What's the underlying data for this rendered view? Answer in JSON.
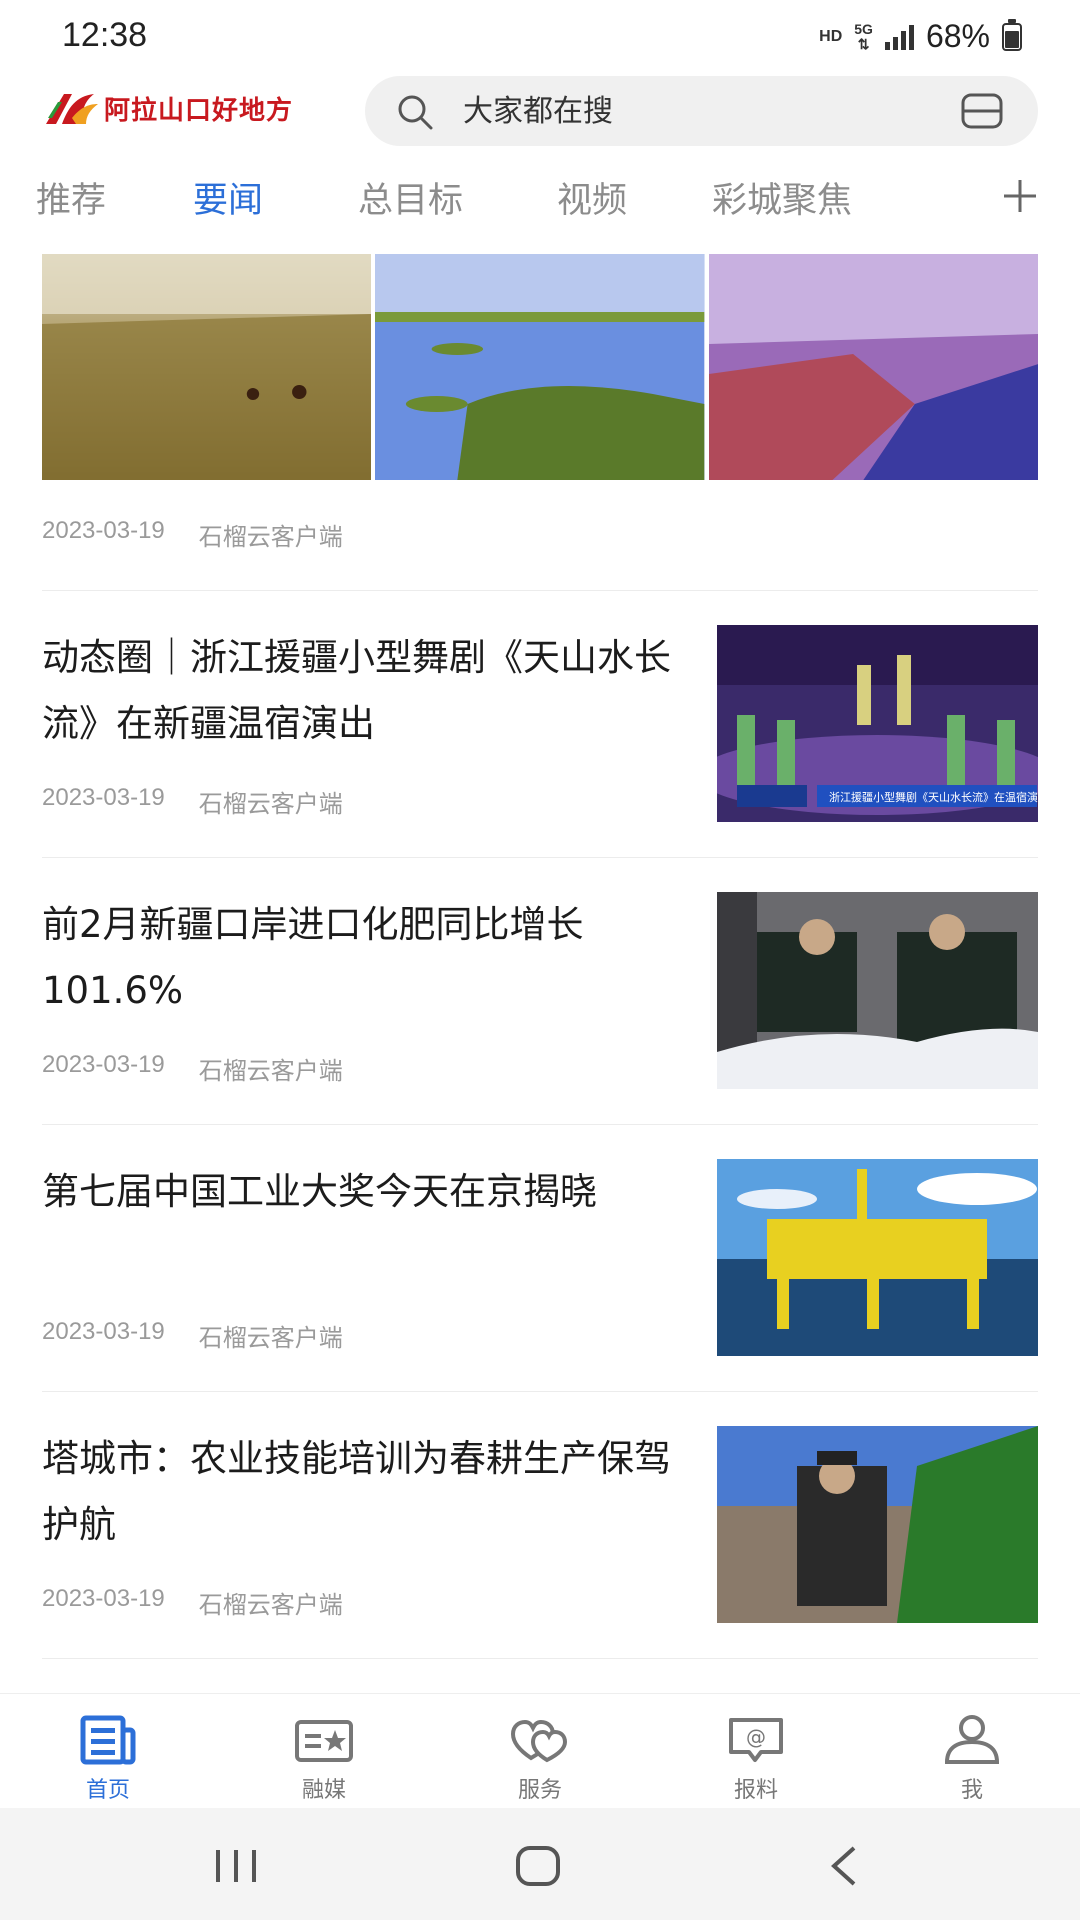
{
  "status_bar": {
    "time": "12:38",
    "hd": "HD",
    "network": "5G",
    "battery": "68%",
    "battery_level": 0.68
  },
  "header": {
    "logo_text": "阿拉山口好地方",
    "search_placeholder": "大家都在搜"
  },
  "tabs": [
    {
      "label": "推荐",
      "active": false
    },
    {
      "label": "要闻",
      "active": true
    },
    {
      "label": "总目标",
      "active": false
    },
    {
      "label": "视频",
      "active": false
    },
    {
      "label": "彩城聚焦",
      "active": false
    }
  ],
  "feed": {
    "gallery_item": {
      "date": "2023-03-19",
      "source": "石榴云客户端"
    },
    "articles": [
      {
        "title": "动态圈｜浙江援疆小型舞剧《天山水长流》在新疆温宿演出",
        "date": "2023-03-19",
        "source": "石榴云客户端",
        "thumb_caption": "浙江援疆小型舞剧《天山水长流》在温宿演出"
      },
      {
        "title": "前2月新疆口岸进口化肥同比增长101.6%",
        "date": "2023-03-19",
        "source": "石榴云客户端"
      },
      {
        "title": "第七届中国工业大奖今天在京揭晓",
        "date": "2023-03-19",
        "source": "石榴云客户端"
      },
      {
        "title": "塔城市：农业技能培训为春耕生产保驾护航",
        "date": "2023-03-19",
        "source": "石榴云客户端"
      }
    ]
  },
  "bottom_nav": [
    {
      "label": "首页",
      "icon": "news-icon",
      "active": true
    },
    {
      "label": "融媒",
      "icon": "media-card-icon",
      "active": false
    },
    {
      "label": "服务",
      "icon": "hearts-icon",
      "active": false
    },
    {
      "label": "报料",
      "icon": "at-chat-icon",
      "active": false
    },
    {
      "label": "我",
      "icon": "user-icon",
      "active": false
    }
  ],
  "colors": {
    "accent": "#2c6fd8",
    "logo_red": "#c8191f",
    "meta_gray": "#9a9a9a"
  }
}
